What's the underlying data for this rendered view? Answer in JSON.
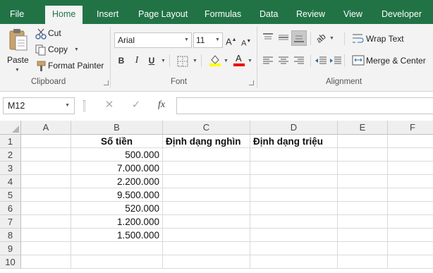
{
  "tabs": [
    "File",
    "Home",
    "Insert",
    "Page Layout",
    "Formulas",
    "Data",
    "Review",
    "View",
    "Developer"
  ],
  "clipboard": {
    "paste": "Paste",
    "cut": "Cut",
    "copy": "Copy",
    "format_painter": "Format Painter",
    "group_label": "Clipboard"
  },
  "font": {
    "font_name": "Arial",
    "font_size": "11",
    "bold": "B",
    "italic": "I",
    "underline": "U",
    "group_label": "Font"
  },
  "alignment": {
    "wrap_text": "Wrap Text",
    "merge_center": "Merge & Center",
    "group_label": "Alignment"
  },
  "formula_bar": {
    "name_box": "M12",
    "fx": "fx",
    "value": ""
  },
  "sheet": {
    "columns": [
      "A",
      "B",
      "C",
      "D",
      "E",
      "F"
    ],
    "rows": [
      "1",
      "2",
      "3",
      "4",
      "5",
      "6",
      "7",
      "8",
      "9",
      "10"
    ],
    "headers": {
      "B1": "Số tiền",
      "C1": "Định dạng nghìn",
      "D1": "Định dạng triệu"
    },
    "amounts": [
      "500.000",
      "7.000.000",
      "2.200.000",
      "9.500.000",
      "520.000",
      "1.200.000",
      "1.500.000"
    ]
  },
  "colors": {
    "accent": "#217346",
    "ribbon_bg": "#f3f3f3",
    "header_bg": "#efefef"
  }
}
